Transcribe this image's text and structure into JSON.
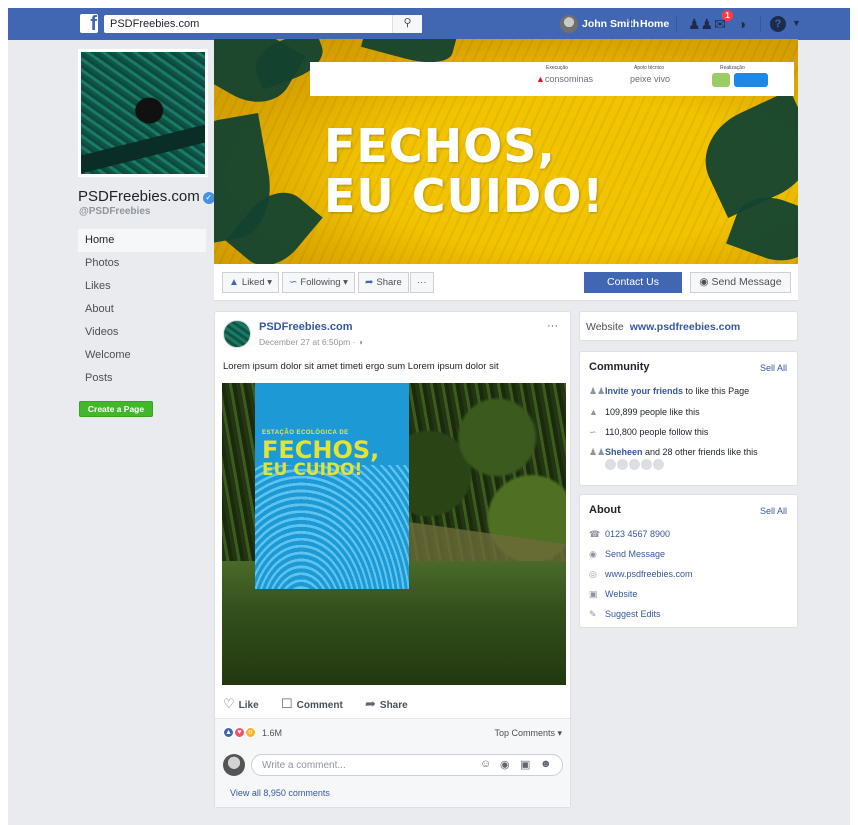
{
  "topbar": {
    "search_value": "PSDFreebies.com",
    "user_name": "John Smith",
    "home_label": "Home",
    "notification_count": "1"
  },
  "page": {
    "name": "PSDFreebies.com",
    "handle": "@PSDFreebies"
  },
  "nav": {
    "items": [
      "Home",
      "Photos",
      "Likes",
      "About",
      "Videos",
      "Welcome",
      "Posts"
    ],
    "create_page": "Create a Page"
  },
  "cover": {
    "headline_line1": "FECHOS,",
    "headline_line2": "EU CUIDO!",
    "sponsor_labels": [
      "Execução",
      "Apoio técnico",
      "Realização"
    ],
    "sponsor_logos": [
      "consominas",
      "peixe vivo"
    ]
  },
  "actions": {
    "liked": "Liked",
    "following": "Following",
    "share": "Share",
    "more": "···",
    "contact": "Contact Us",
    "send_message": "Send Message"
  },
  "post": {
    "author": "PSDFreebies.com",
    "time": "December 27 at 6:50pm",
    "text": "Lorem ipsum dolor sit amet timeti ergo sum Lorem ipsum dolor sit",
    "poster_small": "ESTAÇÃO ECOLÓGICA DE",
    "poster_big": "FECHOS,",
    "poster_big2": "EU CUIDO!",
    "like": "Like",
    "comment": "Comment",
    "share": "Share",
    "reactions_count": "1.6M",
    "top_comments": "Top Comments",
    "comment_placeholder": "Write a comment...",
    "view_all": "View all 8,950 comments"
  },
  "sidebar": {
    "website_label": "Website",
    "website_url": "www.psdfreebies.com",
    "community_title": "Community",
    "see_all": "Sell All",
    "invite_link": "Invite your friends",
    "invite_rest": "to like this Page",
    "likes": "109,899 people like this",
    "follows": "110,800 people follow this",
    "friend_name": "Sheheen",
    "friends_rest": "and 28 other friends like this",
    "about_title": "About",
    "phone": "0123 4567 8900",
    "send_message": "Send Message",
    "site": "www.psdfreebies.com",
    "website": "Website",
    "suggest": "Suggest Edits"
  },
  "colors": {
    "brand": "#4267b2",
    "link": "#365899",
    "create_green": "#42b72a",
    "cover_yellow": "#e6b400"
  }
}
